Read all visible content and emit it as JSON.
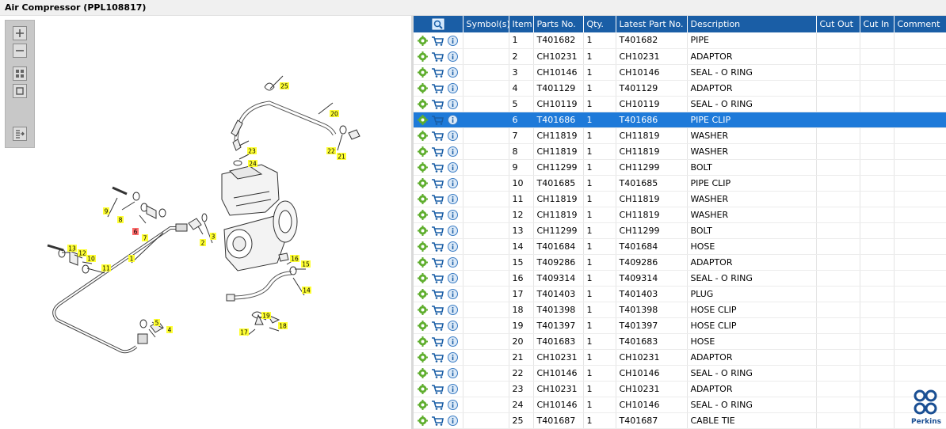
{
  "window": {
    "title": "Air Compressor (PPL108817)"
  },
  "toolbar": {
    "icons": [
      "zoom-in-icon",
      "zoom-out-icon",
      "fit-all-icon",
      "fit-window-icon",
      "list-export-icon"
    ]
  },
  "diagram": {
    "callouts": [
      "1",
      "2",
      "3",
      "4",
      "5",
      "6",
      "7",
      "8",
      "9",
      "10",
      "11",
      "12",
      "13",
      "14",
      "15",
      "16",
      "17",
      "18",
      "19",
      "20",
      "21",
      "22",
      "23",
      "24",
      "25"
    ],
    "callout_color": "#ffff33",
    "selected_callout_color": "#ff6b6b"
  },
  "table": {
    "header_color": "#1a5ea6",
    "selected_color": "#1e7ad9",
    "columns": [
      "Symbol(s)",
      "Item",
      "Parts No.",
      "Qty.",
      "Latest Part No.",
      "Description",
      "Cut Out",
      "Cut In",
      "Comment"
    ],
    "rows": [
      {
        "item": "1",
        "part_no": "T401682",
        "qty": "1",
        "latest": "T401682",
        "desc": "PIPE"
      },
      {
        "item": "2",
        "part_no": "CH10231",
        "qty": "1",
        "latest": "CH10231",
        "desc": "ADAPTOR"
      },
      {
        "item": "3",
        "part_no": "CH10146",
        "qty": "1",
        "latest": "CH10146",
        "desc": "SEAL - O RING"
      },
      {
        "item": "4",
        "part_no": "T401129",
        "qty": "1",
        "latest": "T401129",
        "desc": "ADAPTOR"
      },
      {
        "item": "5",
        "part_no": "CH10119",
        "qty": "1",
        "latest": "CH10119",
        "desc": "SEAL - O RING"
      },
      {
        "item": "6",
        "part_no": "T401686",
        "qty": "1",
        "latest": "T401686",
        "desc": "PIPE CLIP"
      },
      {
        "item": "7",
        "part_no": "CH11819",
        "qty": "1",
        "latest": "CH11819",
        "desc": "WASHER"
      },
      {
        "item": "8",
        "part_no": "CH11819",
        "qty": "1",
        "latest": "CH11819",
        "desc": "WASHER"
      },
      {
        "item": "9",
        "part_no": "CH11299",
        "qty": "1",
        "latest": "CH11299",
        "desc": "BOLT"
      },
      {
        "item": "10",
        "part_no": "T401685",
        "qty": "1",
        "latest": "T401685",
        "desc": "PIPE CLIP"
      },
      {
        "item": "11",
        "part_no": "CH11819",
        "qty": "1",
        "latest": "CH11819",
        "desc": "WASHER"
      },
      {
        "item": "12",
        "part_no": "CH11819",
        "qty": "1",
        "latest": "CH11819",
        "desc": "WASHER"
      },
      {
        "item": "13",
        "part_no": "CH11299",
        "qty": "1",
        "latest": "CH11299",
        "desc": "BOLT"
      },
      {
        "item": "14",
        "part_no": "T401684",
        "qty": "1",
        "latest": "T401684",
        "desc": "HOSE"
      },
      {
        "item": "15",
        "part_no": "T409286",
        "qty": "1",
        "latest": "T409286",
        "desc": "ADAPTOR"
      },
      {
        "item": "16",
        "part_no": "T409314",
        "qty": "1",
        "latest": "T409314",
        "desc": "SEAL - O RING"
      },
      {
        "item": "17",
        "part_no": "T401403",
        "qty": "1",
        "latest": "T401403",
        "desc": "PLUG"
      },
      {
        "item": "18",
        "part_no": "T401398",
        "qty": "1",
        "latest": "T401398",
        "desc": "HOSE CLIP"
      },
      {
        "item": "19",
        "part_no": "T401397",
        "qty": "1",
        "latest": "T401397",
        "desc": "HOSE CLIP"
      },
      {
        "item": "20",
        "part_no": "T401683",
        "qty": "1",
        "latest": "T401683",
        "desc": "HOSE"
      },
      {
        "item": "21",
        "part_no": "CH10231",
        "qty": "1",
        "latest": "CH10231",
        "desc": "ADAPTOR"
      },
      {
        "item": "22",
        "part_no": "CH10146",
        "qty": "1",
        "latest": "CH10146",
        "desc": "SEAL - O RING"
      },
      {
        "item": "23",
        "part_no": "CH10231",
        "qty": "1",
        "latest": "CH10231",
        "desc": "ADAPTOR"
      },
      {
        "item": "24",
        "part_no": "CH10146",
        "qty": "1",
        "latest": "CH10146",
        "desc": "SEAL - O RING"
      },
      {
        "item": "25",
        "part_no": "T401687",
        "qty": "1",
        "latest": "T401687",
        "desc": "CABLE TIE"
      }
    ],
    "selected_item": "6"
  },
  "brand": {
    "name": "Perkins",
    "color": "#1a4f93"
  }
}
